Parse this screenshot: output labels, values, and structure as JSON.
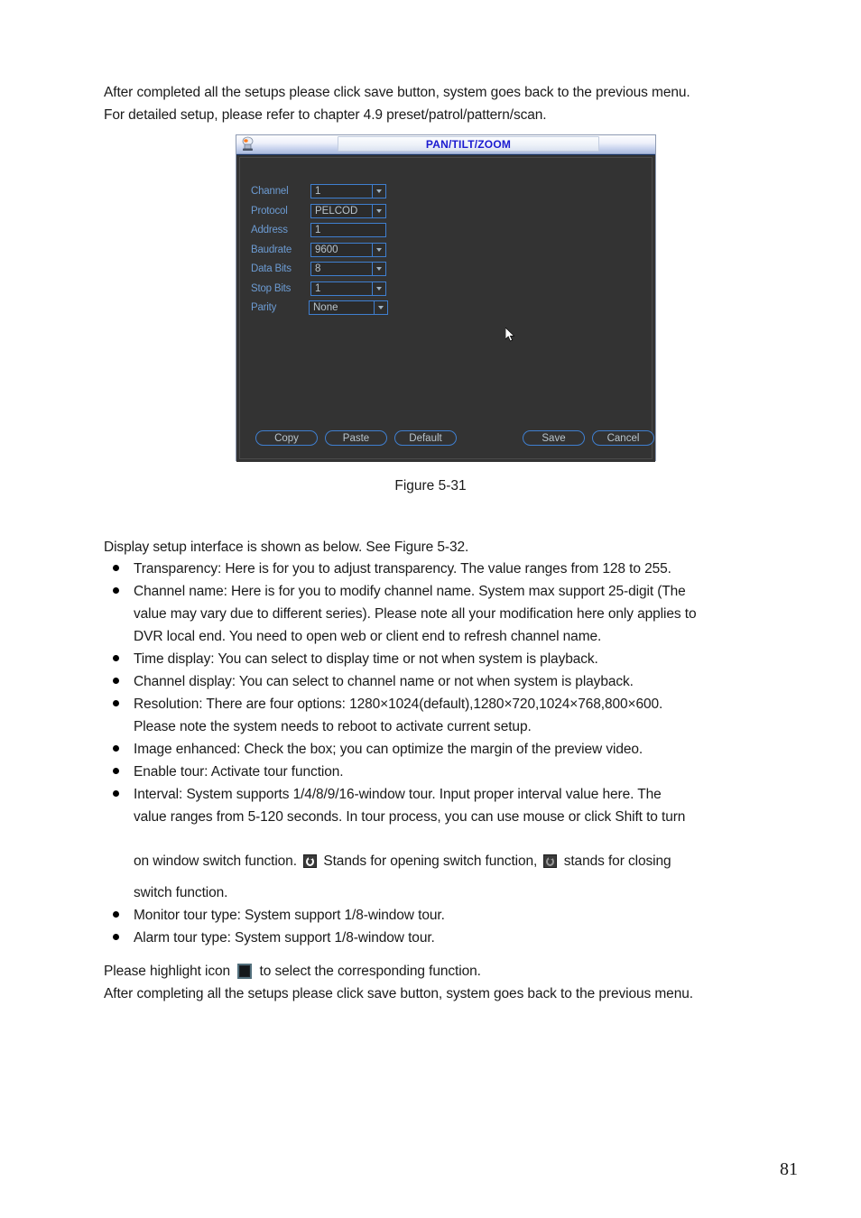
{
  "document": {
    "intro_line1": "After completed all the setups please click save button, system goes back to the previous menu.",
    "intro_line2": "For detailed setup, please refer to chapter 4.9 preset/patrol/pattern/scan.",
    "figure_caption": "Figure 5-31",
    "lead_line": "Display setup interface is shown as below. See Figure 5-32.",
    "closing_line1_a": "Please highlight icon",
    "closing_line1_b": "to select the corresponding function.",
    "closing_line2": "After completing all the setups please click save button, system goes back to the previous menu.",
    "page_number": "81"
  },
  "bullets": [
    {
      "lines": [
        "Transparency: Here is for you to adjust transparency. The value ranges from 128 to 255."
      ]
    },
    {
      "lines": [
        "Channel name: Here is for you to modify channel name. System max support 25-digit (The",
        "value may vary due to different series). Please note all your modification here only applies to",
        "DVR local end. You need to open web or client end to refresh channel name."
      ]
    },
    {
      "lines": [
        "Time display: You can select to display time or not when system is playback."
      ]
    },
    {
      "lines": [
        "Channel display: You can select to channel name or not when system is playback."
      ]
    },
    {
      "lines": [
        "Resolution: There are four options: 1280×1024(default),1280×720,1024×768,800×600.",
        "Please note the system needs to reboot to activate current setup."
      ]
    },
    {
      "lines": [
        "Image enhanced: Check the box; you can optimize the margin of the preview video."
      ]
    },
    {
      "lines": [
        "Enable tour: Activate tour function."
      ]
    },
    {
      "lines": [
        "Interval: System supports 1/4/8/9/16-window tour. Input proper interval value here. The",
        "value ranges from 5-120 seconds. In tour process, you can use mouse or click Shift to turn"
      ],
      "icon_line": {
        "before": "on window switch function.",
        "middle": "Stands for opening switch function,",
        "after": "stands for closing"
      },
      "tail": "switch function."
    },
    {
      "lines": [
        "Monitor tour type: System support 1/8-window tour."
      ]
    },
    {
      "lines": [
        "Alarm tour type: System support 1/8-window tour."
      ]
    }
  ],
  "dialog": {
    "title": "PAN/TILT/ZOOM",
    "title_icon": "ptz-camera-icon",
    "fields": [
      {
        "label": "Channel",
        "value": "1",
        "type": "select"
      },
      {
        "label": "Protocol",
        "value": "PELCOD",
        "type": "select"
      },
      {
        "label": "Address",
        "value": "1",
        "type": "input"
      },
      {
        "label": "Baudrate",
        "value": "9600",
        "type": "select"
      },
      {
        "label": "Data Bits",
        "value": "8",
        "type": "select"
      },
      {
        "label": "Stop Bits",
        "value": "1",
        "type": "select"
      },
      {
        "label": "Parity",
        "value": "None",
        "type": "select"
      }
    ],
    "buttons": {
      "copy": "Copy",
      "paste": "Paste",
      "default": "Default",
      "save": "Save",
      "cancel": "Cancel"
    },
    "colors": {
      "window_bg": "#333333",
      "label_blue": "#6c9bd2",
      "field_border": "#3f7fd0",
      "value_text": "#b9c4cc",
      "title_text": "#1a1ad0"
    }
  }
}
